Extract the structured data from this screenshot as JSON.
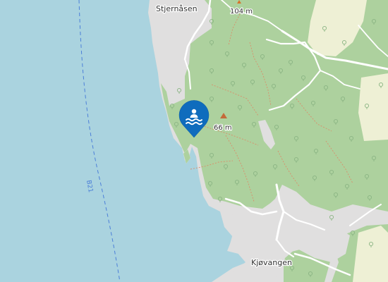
{
  "map": {
    "places": {
      "north": "Stjernåsen",
      "south": "Kjøvangen"
    },
    "elevations": {
      "summit_north": "104 m",
      "summit_mid": "66 m"
    },
    "maritime_route": "B21",
    "marker": {
      "icon": "swimming-icon",
      "color": "#0f6cbd"
    },
    "colors": {
      "water": "#aad3df",
      "forest": "#add19e",
      "residential": "#e0dfdf",
      "farmland": "#eef0d5",
      "route": "#4c7fd8",
      "road": "#ffffff"
    }
  }
}
